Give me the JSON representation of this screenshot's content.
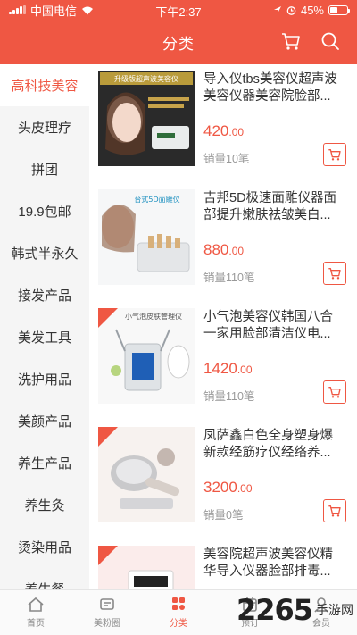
{
  "status_bar": {
    "carrier": "中国电信",
    "time": "下午2:37",
    "battery": "45%"
  },
  "colors": {
    "accent": "#ef5743"
  },
  "nav": {
    "title": "分类",
    "icons": [
      "cart-icon",
      "search-icon"
    ]
  },
  "sidebar": {
    "items": [
      {
        "label": "高科技美容",
        "active": true
      },
      {
        "label": "头皮理疗"
      },
      {
        "label": "拼团"
      },
      {
        "label": "19.9包邮"
      },
      {
        "label": "韩式半永久"
      },
      {
        "label": "接发产品"
      },
      {
        "label": "美发工具"
      },
      {
        "label": "洗护用品"
      },
      {
        "label": "美颜产品"
      },
      {
        "label": "养生产品"
      },
      {
        "label": "养生灸"
      },
      {
        "label": "烫染用品"
      },
      {
        "label": "养生餐"
      }
    ]
  },
  "products": [
    {
      "name": "导入仪tbs美容仪超声波美容仪器美容院脸部...",
      "price_int": "420",
      "price_dec": ".00",
      "sales": "销量10笔",
      "thumb_text": "升级版超声波美容仪"
    },
    {
      "name": "吉邦5D极速面雕仪器面部提升嫩肤祛皱美白...",
      "price_int": "880",
      "price_dec": ".00",
      "sales": "销量110笔",
      "thumb_text": "台式5D面雕仪"
    },
    {
      "name": "小气泡美容仪韩国八合一家用脸部清洁仪电...",
      "price_int": "1420",
      "price_dec": ".00",
      "sales": "销量110笔",
      "thumb_text": "小气泡皮肤管理仪"
    },
    {
      "name": "凤萨鑫白色全身塑身爆新款经筋疗仪经络养...",
      "price_int": "3200",
      "price_dec": ".00",
      "sales": "销量0笔",
      "thumb_text": ""
    },
    {
      "name": "美容院超声波美容仪精华导入仪器脸部排毒...",
      "price_int": "",
      "price_dec": "",
      "sales": "",
      "thumb_text": ""
    }
  ],
  "tabbar": {
    "items": [
      {
        "label": "首页",
        "icon": "home-icon"
      },
      {
        "label": "美粉圈",
        "icon": "circle-icon"
      },
      {
        "label": "分类",
        "icon": "category-icon",
        "active": true
      },
      {
        "label": "预订",
        "icon": "booking-icon"
      },
      {
        "label": "会员",
        "icon": "member-icon"
      }
    ]
  },
  "watermark": {
    "number": "2265",
    "text": "手游网"
  }
}
